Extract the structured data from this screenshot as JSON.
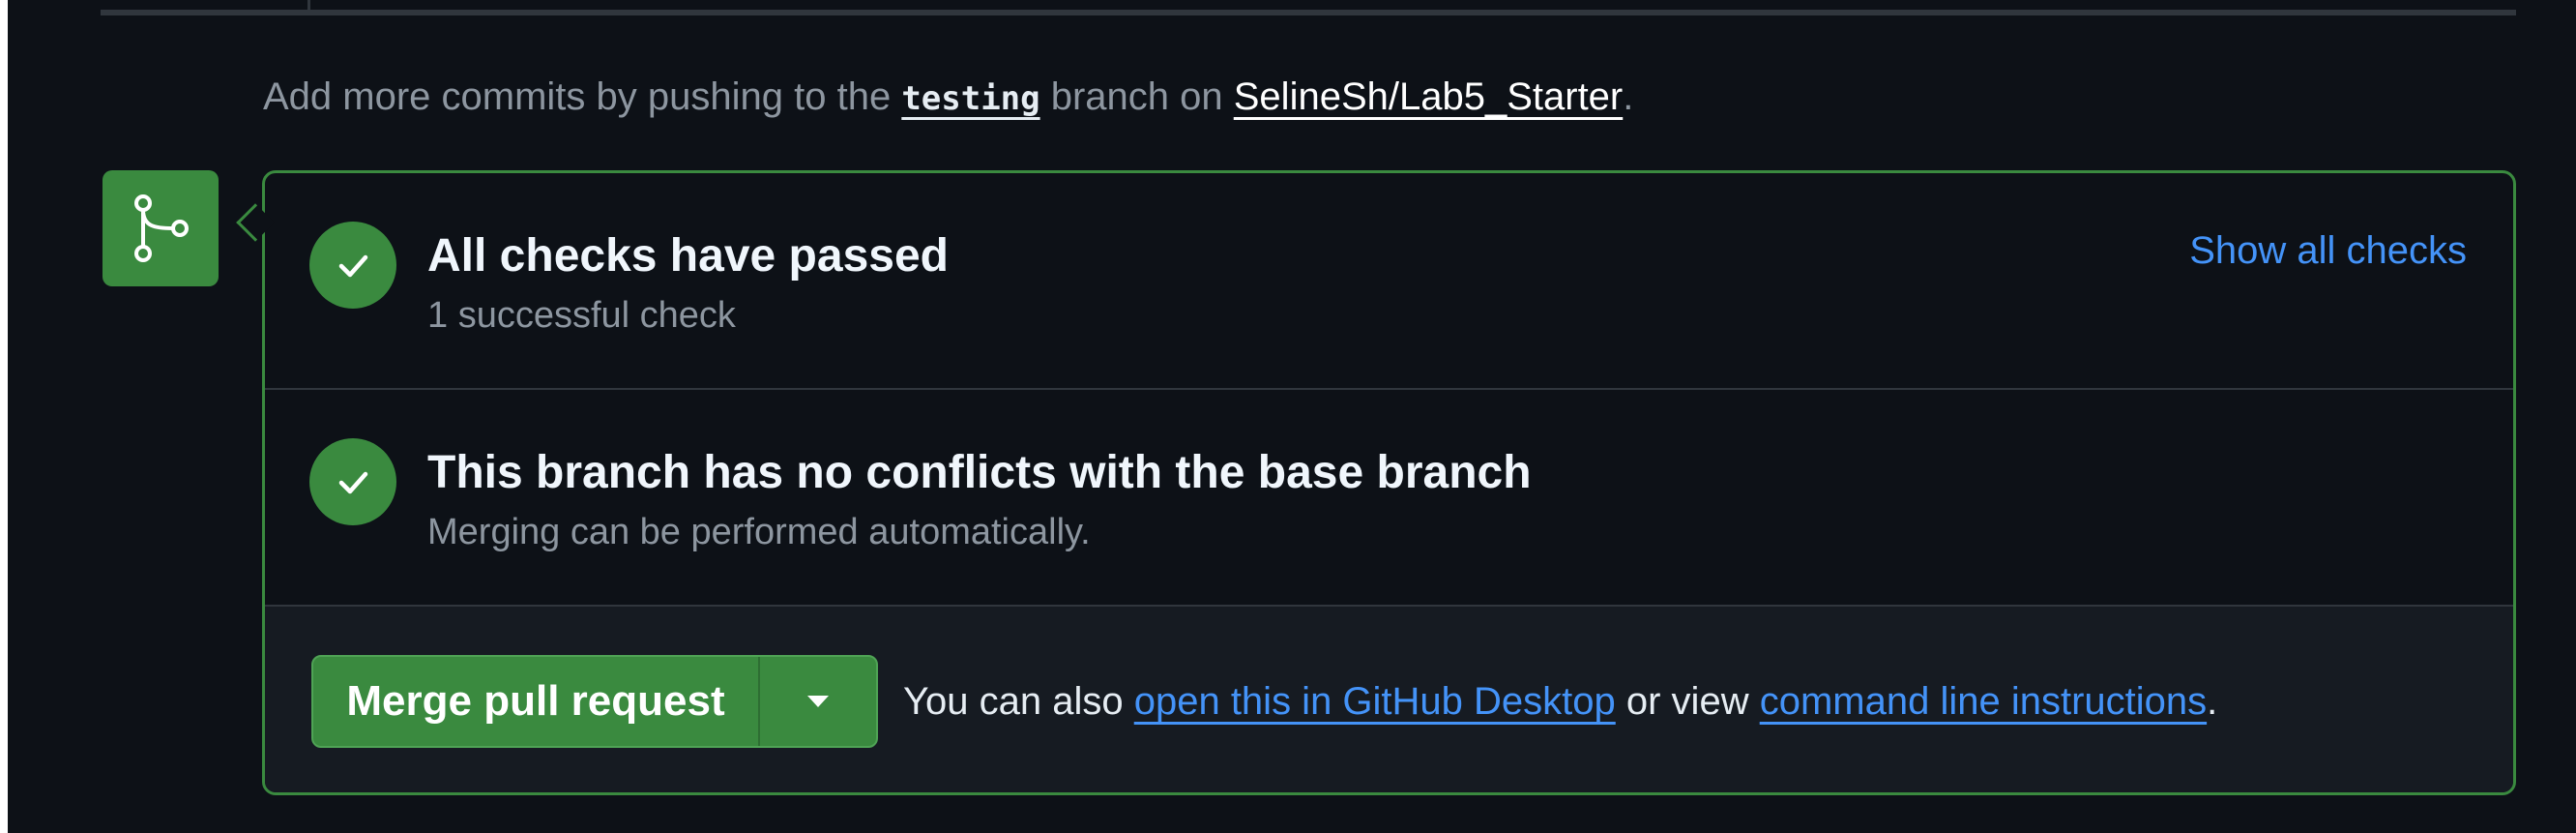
{
  "hint": {
    "prefix": "Add more commits by pushing to the ",
    "branch": "testing",
    "middle": " branch on ",
    "repo": "SelineSh/Lab5_Starter",
    "suffix": "."
  },
  "checks": {
    "title": "All checks have passed",
    "subtitle": "1 successful check",
    "show_all_label": "Show all checks"
  },
  "conflicts": {
    "title": "This branch has no conflicts with the base branch",
    "subtitle": "Merging can be performed automatically."
  },
  "merge": {
    "button_label": "Merge pull request",
    "also_prefix": "You can also ",
    "desktop_link": "open this in GitHub Desktop",
    "also_middle": " or view ",
    "cli_link": "command line instructions",
    "also_suffix": "."
  },
  "icons": {
    "badge": "git-merge-icon",
    "check": "check-icon",
    "caret": "triangle-down-icon"
  },
  "colors": {
    "success": "#3a8a3f",
    "link": "#4493f8",
    "background": "#0d1117"
  }
}
